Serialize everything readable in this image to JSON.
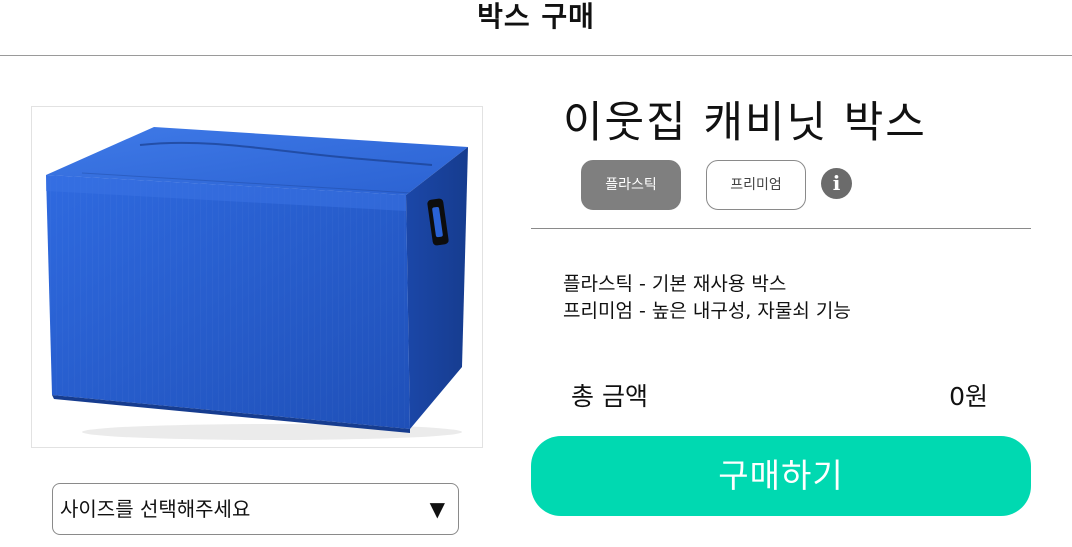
{
  "header": {
    "title": "박스 구매"
  },
  "product": {
    "name": "이웃집 캐비닛 박스",
    "image_icon": "blue-plastic-box-image"
  },
  "options": {
    "plastic_label": "플라스틱",
    "premium_label": "프리미엄",
    "selected": "플라스틱",
    "info_icon": "info-icon",
    "info_glyph": "i"
  },
  "descriptions": {
    "line1": "플라스틱 - 기본 재사용 박스",
    "line2": "프리미엄 - 높은 내구성, 자물쇠 기능"
  },
  "size_select": {
    "label": "사이즈를 선택해주세요",
    "arrow": "▼"
  },
  "total": {
    "label": "총 금액",
    "value": "0원"
  },
  "buy_button": {
    "label": "구매하기"
  },
  "colors": {
    "accent": "#00d9b1",
    "selected_option": "#7f7f7f",
    "box_blue": "#2a62d4"
  }
}
